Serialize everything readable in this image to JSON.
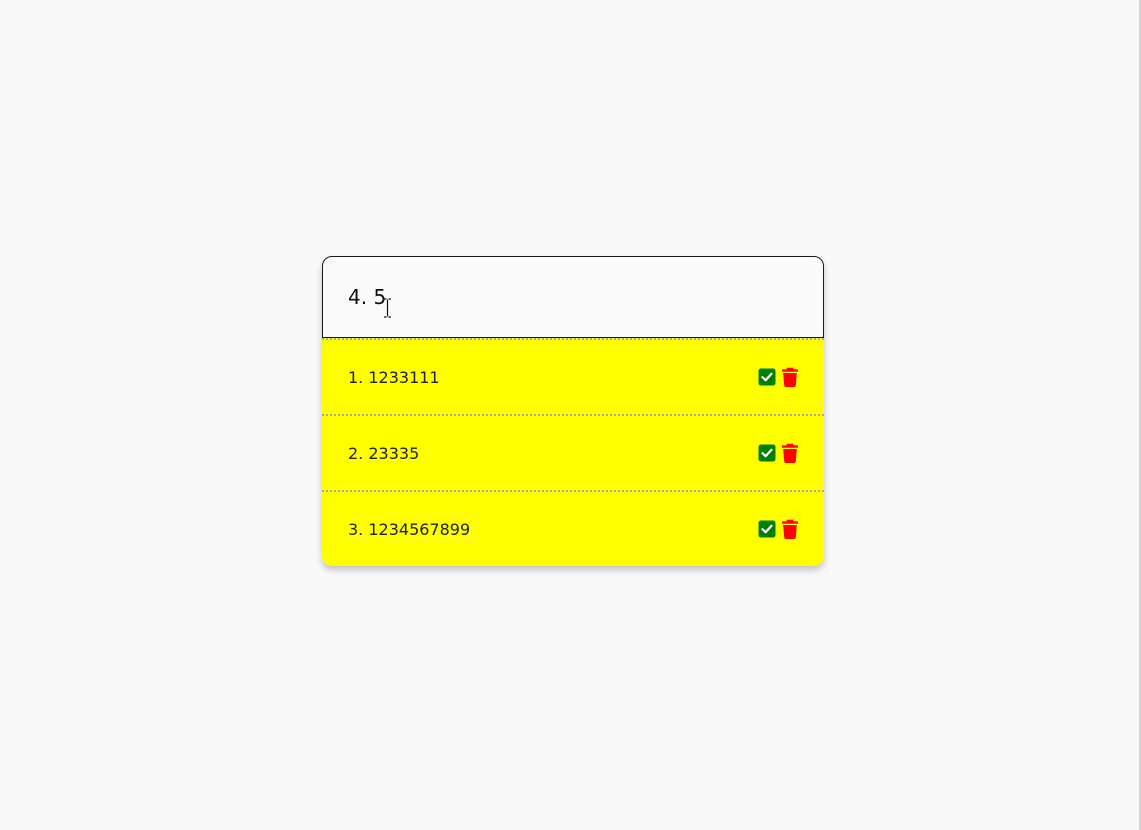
{
  "input": {
    "value": "4. 5",
    "placeholder": ""
  },
  "todos": [
    {
      "label": "1. 1233111",
      "check_icon": "check-square-icon",
      "delete_icon": "trash-icon"
    },
    {
      "label": "2. 23335",
      "check_icon": "check-square-icon",
      "delete_icon": "trash-icon"
    },
    {
      "label": "3. 1234567899",
      "check_icon": "check-square-icon",
      "delete_icon": "trash-icon"
    }
  ],
  "colors": {
    "item_background": "#ffff00",
    "check": "#008000",
    "delete": "#ff0000",
    "page_background": "#f9f9f9"
  }
}
